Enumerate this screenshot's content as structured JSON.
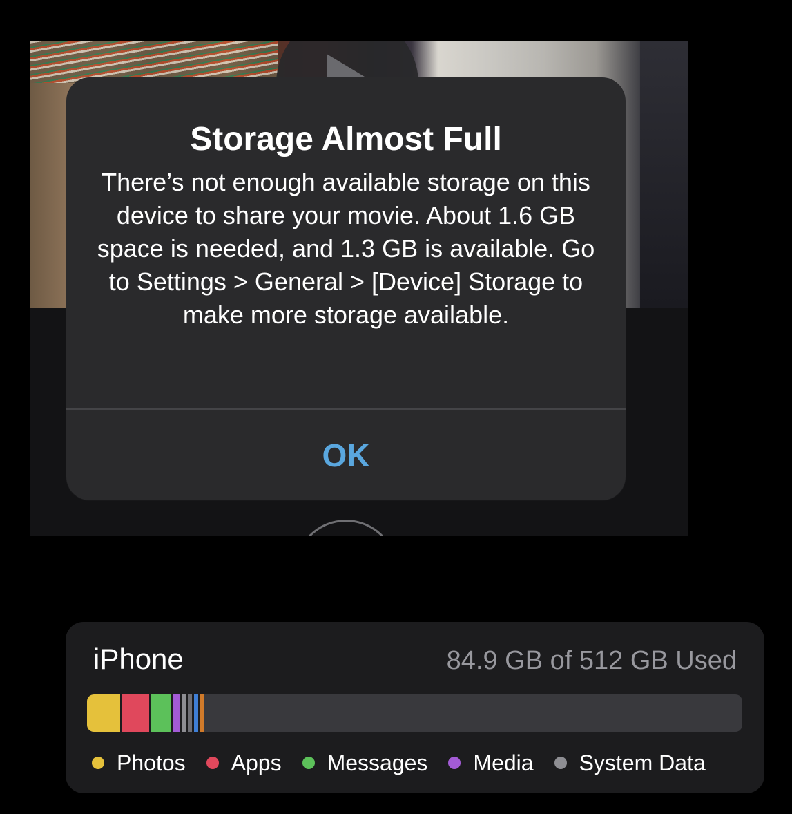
{
  "alert": {
    "title": "Storage Almost Full",
    "message": "There’s not enough available storage on this device to share your movie. About 1.6 GB space is needed, and 1.3 GB is available. Go to Settings > General > [Device] Storage to make more storage available.",
    "ok_label": "OK",
    "ok_color": "#5aa7df"
  },
  "storage": {
    "device_name": "iPhone",
    "usage": "84.9 GB of 512 GB Used",
    "used_fraction": 0.166,
    "segments": [
      {
        "category": "Photos",
        "color": "#e5c13b"
      },
      {
        "category": "Apps",
        "color": "#e0485c"
      },
      {
        "category": "Messages",
        "color": "#5cc15a"
      },
      {
        "category": "Media",
        "color": "#a35bd6"
      },
      {
        "category": "System Data",
        "color": "#8e8e93"
      }
    ],
    "legend": [
      {
        "label": "Photos",
        "color": "#e5c13b"
      },
      {
        "label": "Apps",
        "color": "#e0485c"
      },
      {
        "label": "Messages",
        "color": "#5cc15a"
      },
      {
        "label": "Media",
        "color": "#a35bd6"
      },
      {
        "label": "System Data",
        "color": "#8e8e93"
      }
    ]
  },
  "background": {
    "play_icon": "play-icon",
    "record_icon": "record-button-icon"
  }
}
